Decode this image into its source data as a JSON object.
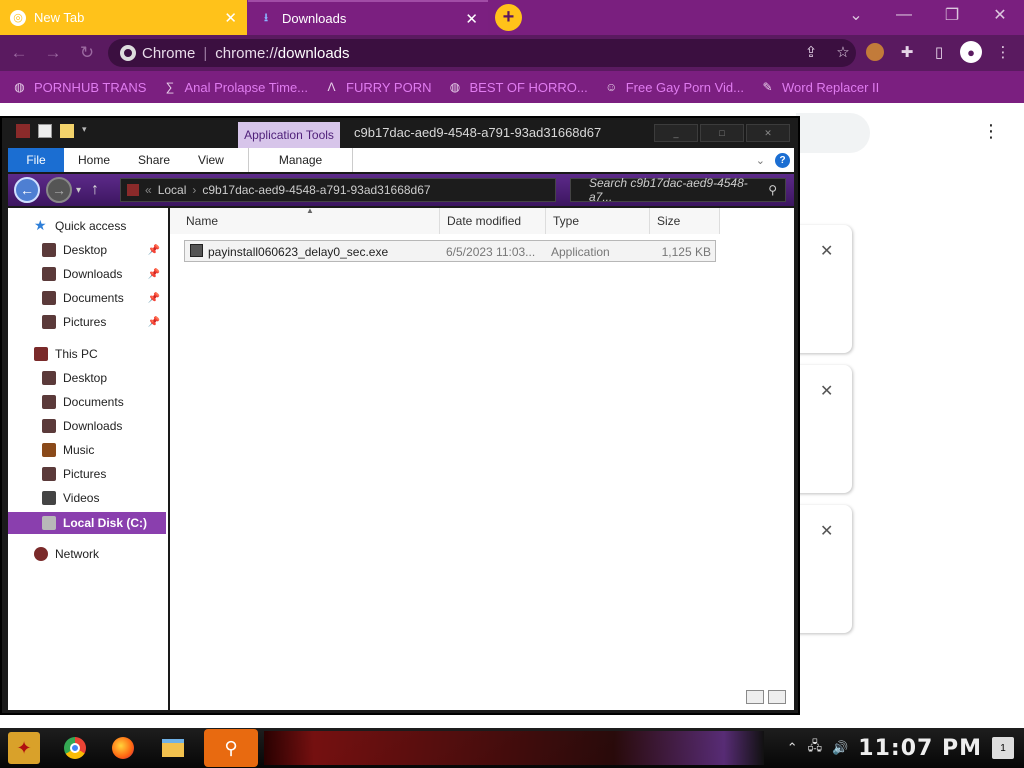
{
  "browser": {
    "tabs": [
      {
        "title": "New Tab",
        "active": false
      },
      {
        "title": "Downloads",
        "active": true
      }
    ],
    "omnibox": {
      "site": "Chrome",
      "url_prefix": "chrome://",
      "url_path": "downloads"
    },
    "bookmarks": [
      {
        "label": "PORNHUB TRANS",
        "icon": "globe-icon"
      },
      {
        "label": "Anal Prolapse Time...",
        "icon": "bookmark-icon"
      },
      {
        "label": "FURRY PORN",
        "icon": "lambda-icon"
      },
      {
        "label": "BEST OF HORRO...",
        "icon": "globe-icon"
      },
      {
        "label": "Free Gay Porn Vid...",
        "icon": "face-icon"
      },
      {
        "label": "Word Replacer II",
        "icon": "wr-icon"
      }
    ],
    "colors": {
      "tab_active_accent": "#ffc21a",
      "frame": "#7a1f7f",
      "bookmark_text": "#e07cf0"
    }
  },
  "explorer": {
    "context_tab": "Application Tools",
    "title": "c9b17dac-aed9-4548-a791-93ad31668d67",
    "ribbon_tabs": [
      "File",
      "Home",
      "Share",
      "View",
      "Manage"
    ],
    "address": {
      "root": "Local",
      "folder": "c9b17dac-aed9-4548-a791-93ad31668d67"
    },
    "search_placeholder": "Search c9b17dac-aed9-4548-a7...",
    "nav": {
      "quick_access": "Quick access",
      "quick_items": [
        "Desktop",
        "Downloads",
        "Documents",
        "Pictures"
      ],
      "this_pc": "This PC",
      "pc_items": [
        "Desktop",
        "Documents",
        "Downloads",
        "Music",
        "Pictures",
        "Videos"
      ],
      "selected": "Local Disk (C:)",
      "network": "Network"
    },
    "columns": [
      "Name",
      "Date modified",
      "Type",
      "Size"
    ],
    "files": [
      {
        "name": "payinstall060623_delay0_sec.exe",
        "date": "6/5/2023 11:03...",
        "type": "Application",
        "size": "1,125 KB"
      }
    ]
  },
  "taskbar": {
    "clock": "11:07 PM",
    "notification_count": "1"
  }
}
